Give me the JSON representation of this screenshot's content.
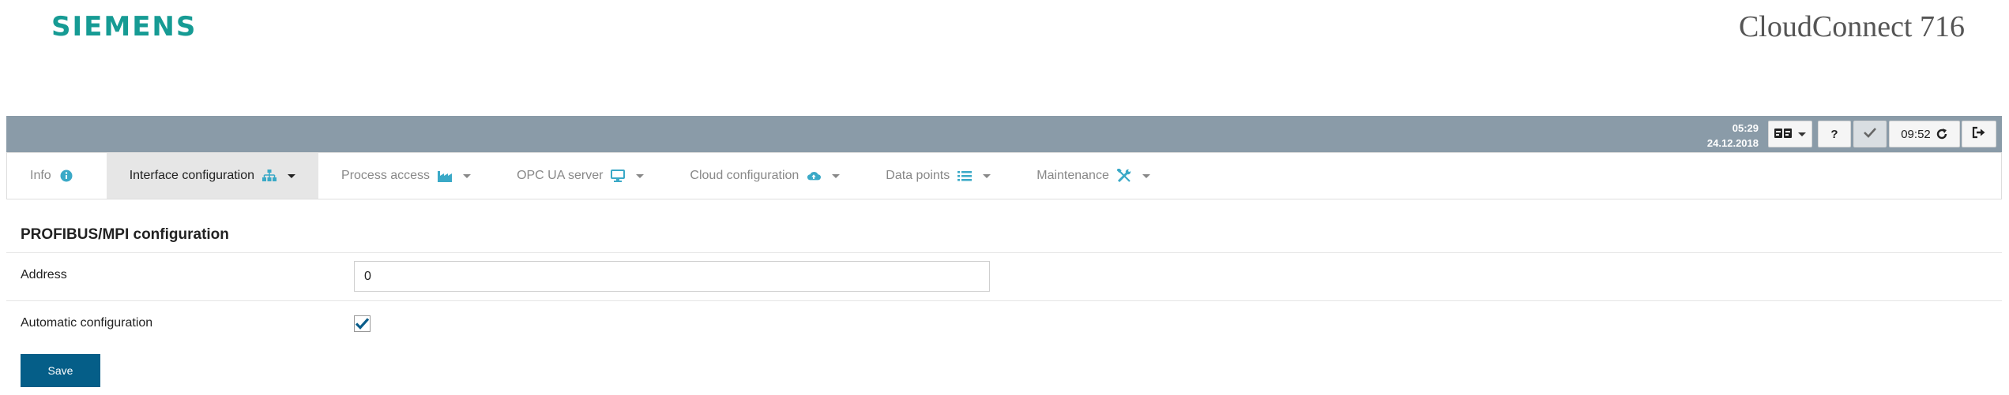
{
  "header": {
    "logo": "SIEMENS",
    "product_name": "CloudConnect 716"
  },
  "statusbar": {
    "time": "05:29",
    "date": "24.12.2018",
    "session_timer": "09:52",
    "buttons": [
      {
        "name": "language-dropdown",
        "icon": "language-icon"
      },
      {
        "name": "help",
        "icon": "question-icon",
        "label": "?"
      },
      {
        "name": "confirm",
        "icon": "check-icon"
      },
      {
        "name": "session-refresh",
        "icon": "refresh-icon"
      },
      {
        "name": "logout",
        "icon": "logout-icon"
      }
    ]
  },
  "nav": {
    "tabs": [
      {
        "label": "Info",
        "icon": "info-icon"
      },
      {
        "label": "Interface configuration",
        "icon": "network-icon",
        "active": true
      },
      {
        "label": "Process access",
        "icon": "factory-icon"
      },
      {
        "label": "OPC UA server",
        "icon": "monitor-icon"
      },
      {
        "label": "Cloud configuration",
        "icon": "cloud-upload-icon"
      },
      {
        "label": "Data points",
        "icon": "list-icon"
      },
      {
        "label": "Maintenance",
        "icon": "tools-icon"
      }
    ]
  },
  "form": {
    "title": "PROFIBUS/MPI configuration",
    "address_label": "Address",
    "address_value": "0",
    "auto_config_label": "Automatic configuration",
    "auto_config_checked": true,
    "save_label": "Save"
  },
  "colors": {
    "brand": "#169b94",
    "statusbar": "#8a9ba8",
    "accent_icon": "#3aa9c7",
    "primary_button": "#055e88"
  }
}
